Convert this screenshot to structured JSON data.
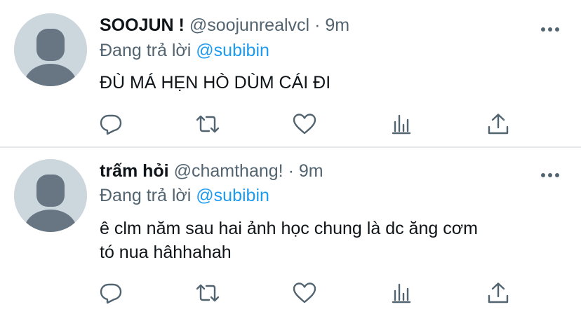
{
  "tweets": [
    {
      "author_name": "SOOJUN !",
      "handle": "@soojunrealvcl",
      "separator": "·",
      "time": "9m",
      "replying_prefix": "Đang trả lời",
      "replying_to": "@subibin",
      "text_lines": [
        "ĐÙ MÁ HẸN HÒ DÙM CÁI ĐI"
      ]
    },
    {
      "author_name": "trấm hỏi",
      "handle": "@chamthang!",
      "separator": "·",
      "time": "9m",
      "replying_prefix": "Đang trả lời",
      "replying_to": "@subibin",
      "text_lines": [
        "ê clm năm sau hai ảnh học chung là dc ăng cơm",
        "tó nua hâhhahah"
      ]
    }
  ],
  "icons": {
    "more": "more-horizontal-icon",
    "reply": "reply-icon",
    "retweet": "retweet-icon",
    "like": "like-icon",
    "views": "analytics-icon",
    "share": "share-icon"
  },
  "colors": {
    "text_primary": "#0f1419",
    "text_secondary": "#536471",
    "mention": "#1d9bf0",
    "avatar_bg": "#ccd6dd",
    "avatar_fg": "#687684",
    "divider": "#e3e7ea"
  }
}
